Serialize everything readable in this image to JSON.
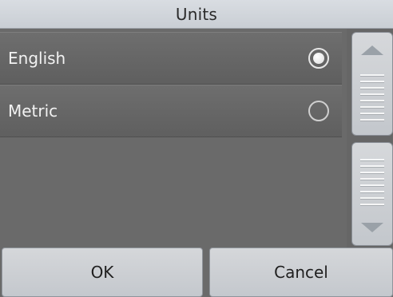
{
  "dialog": {
    "title": "Units",
    "options": [
      {
        "label": "English",
        "selected": true
      },
      {
        "label": "Metric",
        "selected": false
      }
    ],
    "buttons": {
      "ok": "OK",
      "cancel": "Cancel"
    },
    "icons": {
      "scroll_up": "triangle-up-icon",
      "scroll_down": "triangle-down-icon",
      "radio_selected": "radio-selected-icon",
      "radio_unselected": "radio-unselected-icon"
    },
    "colors": {
      "background": "#6a6a6a",
      "titlebar": "#d2d6db",
      "button": "#cfd2d6"
    }
  }
}
